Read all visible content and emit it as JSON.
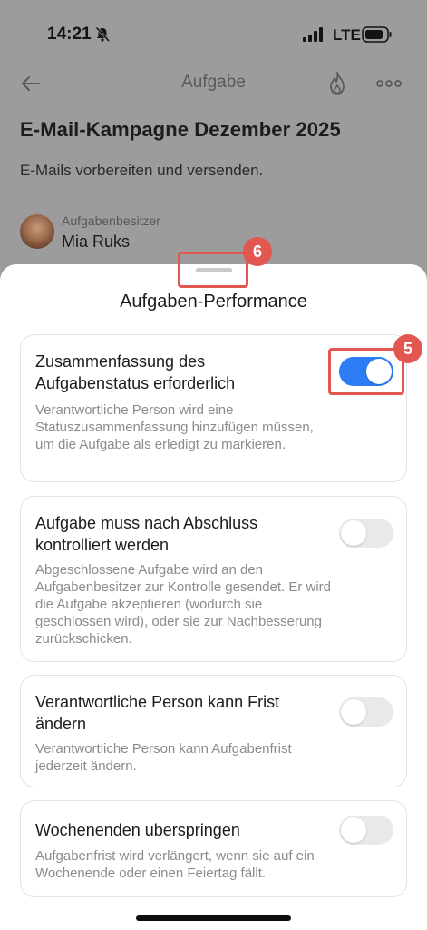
{
  "status_bar": {
    "time": "14:21",
    "network": "LTE"
  },
  "nav": {
    "title": "Aufgabe"
  },
  "task": {
    "title": "E-Mail-Kampagne Dezember 2025",
    "description": "E-Mails vorbereiten und versenden.",
    "owner_label": "Aufgabenbesitzer",
    "owner_name": "Mia Ruks"
  },
  "sheet": {
    "title": "Aufgaben-Performance",
    "badges": {
      "grabber": "6",
      "toggle": "5"
    },
    "options": [
      {
        "title": "Zusammenfassung des Aufgabenstatus erforderlich",
        "description": "Verantwortliche Person wird eine Statuszusammenfassung hinzufügen müssen, um die Aufgabe als erledigt zu markieren.",
        "enabled": true
      },
      {
        "title": "Aufgabe muss nach Abschluss kontrolliert werden",
        "description": "Abgeschlossene Aufgabe wird an den Aufgabenbesitzer zur Kontrolle gesendet. Er wird die Aufgabe akzeptieren (wodurch sie geschlossen wird), oder  sie zur Nachbesserung zurückschicken.",
        "enabled": false
      },
      {
        "title": "Verantwortliche Person kann Frist ändern",
        "description": "Verantwortliche Person kann Aufgabenfrist jederzeit ändern.",
        "enabled": false
      },
      {
        "title": "Wochenenden uberspringen",
        "description": "Aufgabenfrist wird verlängert, wenn sie auf ein Wochenende oder einen Feiertag fällt.",
        "enabled": false
      }
    ]
  },
  "colors": {
    "accent": "#2d7cf6",
    "highlight": "#e2574f",
    "dim_overlay": "#9c9c9c"
  },
  "icons": [
    "bell-slash-icon",
    "signal-icon",
    "battery-icon",
    "back-arrow-icon",
    "flame-icon",
    "more-icon"
  ]
}
